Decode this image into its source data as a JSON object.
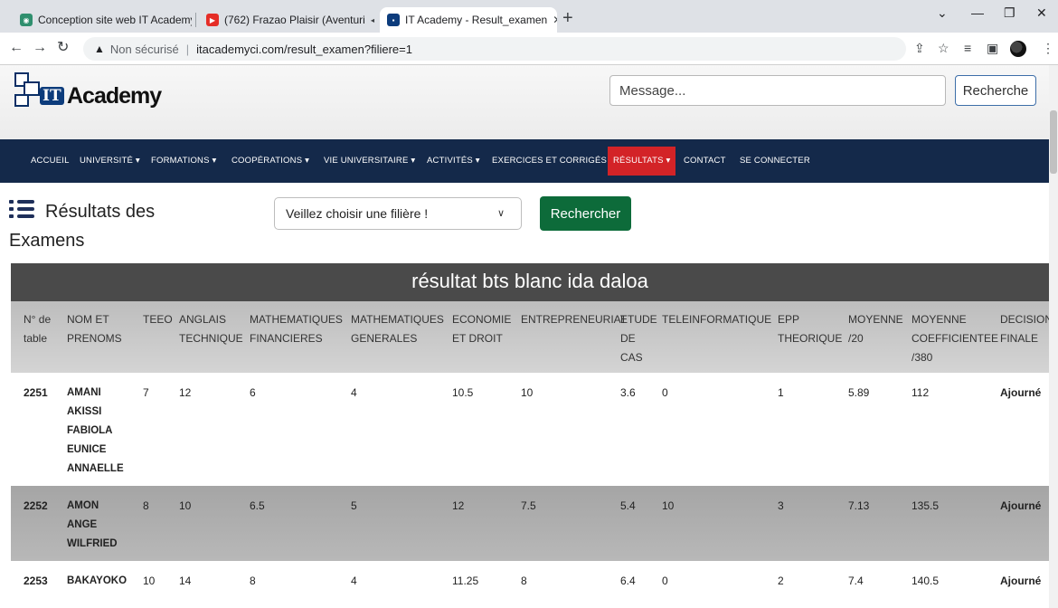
{
  "browser": {
    "tabs": [
      {
        "title": "Conception site web IT Academy.",
        "favicon_color": "#2f8f6e"
      },
      {
        "title": "(762) Frazao Plaisir (Aventuri",
        "favicon_color": "#e52d27"
      },
      {
        "title": "IT Academy - Result_examen",
        "favicon_color": "#0d3c7c"
      }
    ],
    "security_label": "Non sécurisé",
    "url": "itacademyci.com/result_examen?filiere=1"
  },
  "header": {
    "logo_it": "IT",
    "logo_text": "Academy",
    "message_placeholder": "Message...",
    "search_label": "Recherche"
  },
  "nav": {
    "items": [
      "ACCUEIL",
      "UNIVERSITÉ ▾",
      "FORMATIONS ▾",
      "COOPÉRATIONS ▾",
      "VIE UNIVERSITAIRE ▾",
      "ACTIVITÉS ▾",
      "EXERCICES ET CORRIGÉS",
      "RÉSULTATS ▾",
      "CONTACT",
      "SE CONNECTER"
    ],
    "active": "RÉSULTATS ▾",
    "active_color": "#d32327",
    "bg_color": "#14294a"
  },
  "main": {
    "title_line1": "Résultats des",
    "title_line2": "Examens",
    "filiere_select": "Veillez choisir une filière !",
    "rechercher_label": "Rechercher",
    "rechercher_color": "#0d6b3a",
    "banner": "résultat bts blanc ida daloa"
  },
  "table": {
    "headers": [
      "N° de table",
      "NOM ET PRENOMS",
      "TEEO",
      "ANGLAIS TECHNIQUE",
      "MATHEMATIQUES FINANCIERES",
      "MATHEMATIQUES GENERALES",
      "ECONOMIE ET DROIT",
      "ENTREPRENEURIAT",
      "ETUDE DE CAS",
      "TELEINFORMATIQUE",
      "EPP THEORIQUE",
      "MOYENNE /20",
      "MOYENNE COEFFICIENTEE /380",
      "DECISION FINALE"
    ],
    "rows": [
      [
        "2251",
        "AMANI AKISSI FABIOLA EUNICE ANNAELLE",
        "7",
        "12",
        "6",
        "4",
        "10.5",
        "10",
        "3.6",
        "0",
        "1",
        "5.89",
        "112",
        "Ajourné"
      ],
      [
        "2252",
        "AMON ANGE WILFRIED",
        "8",
        "10",
        "6.5",
        "5",
        "12",
        "7.5",
        "5.4",
        "10",
        "3",
        "7.13",
        "135.5",
        "Ajourné"
      ],
      [
        "2253",
        "BAKAYOKO",
        "10",
        "14",
        "8",
        "4",
        "11.25",
        "8",
        "6.4",
        "0",
        "2",
        "7.4",
        "140.5",
        "Ajourné"
      ]
    ]
  }
}
